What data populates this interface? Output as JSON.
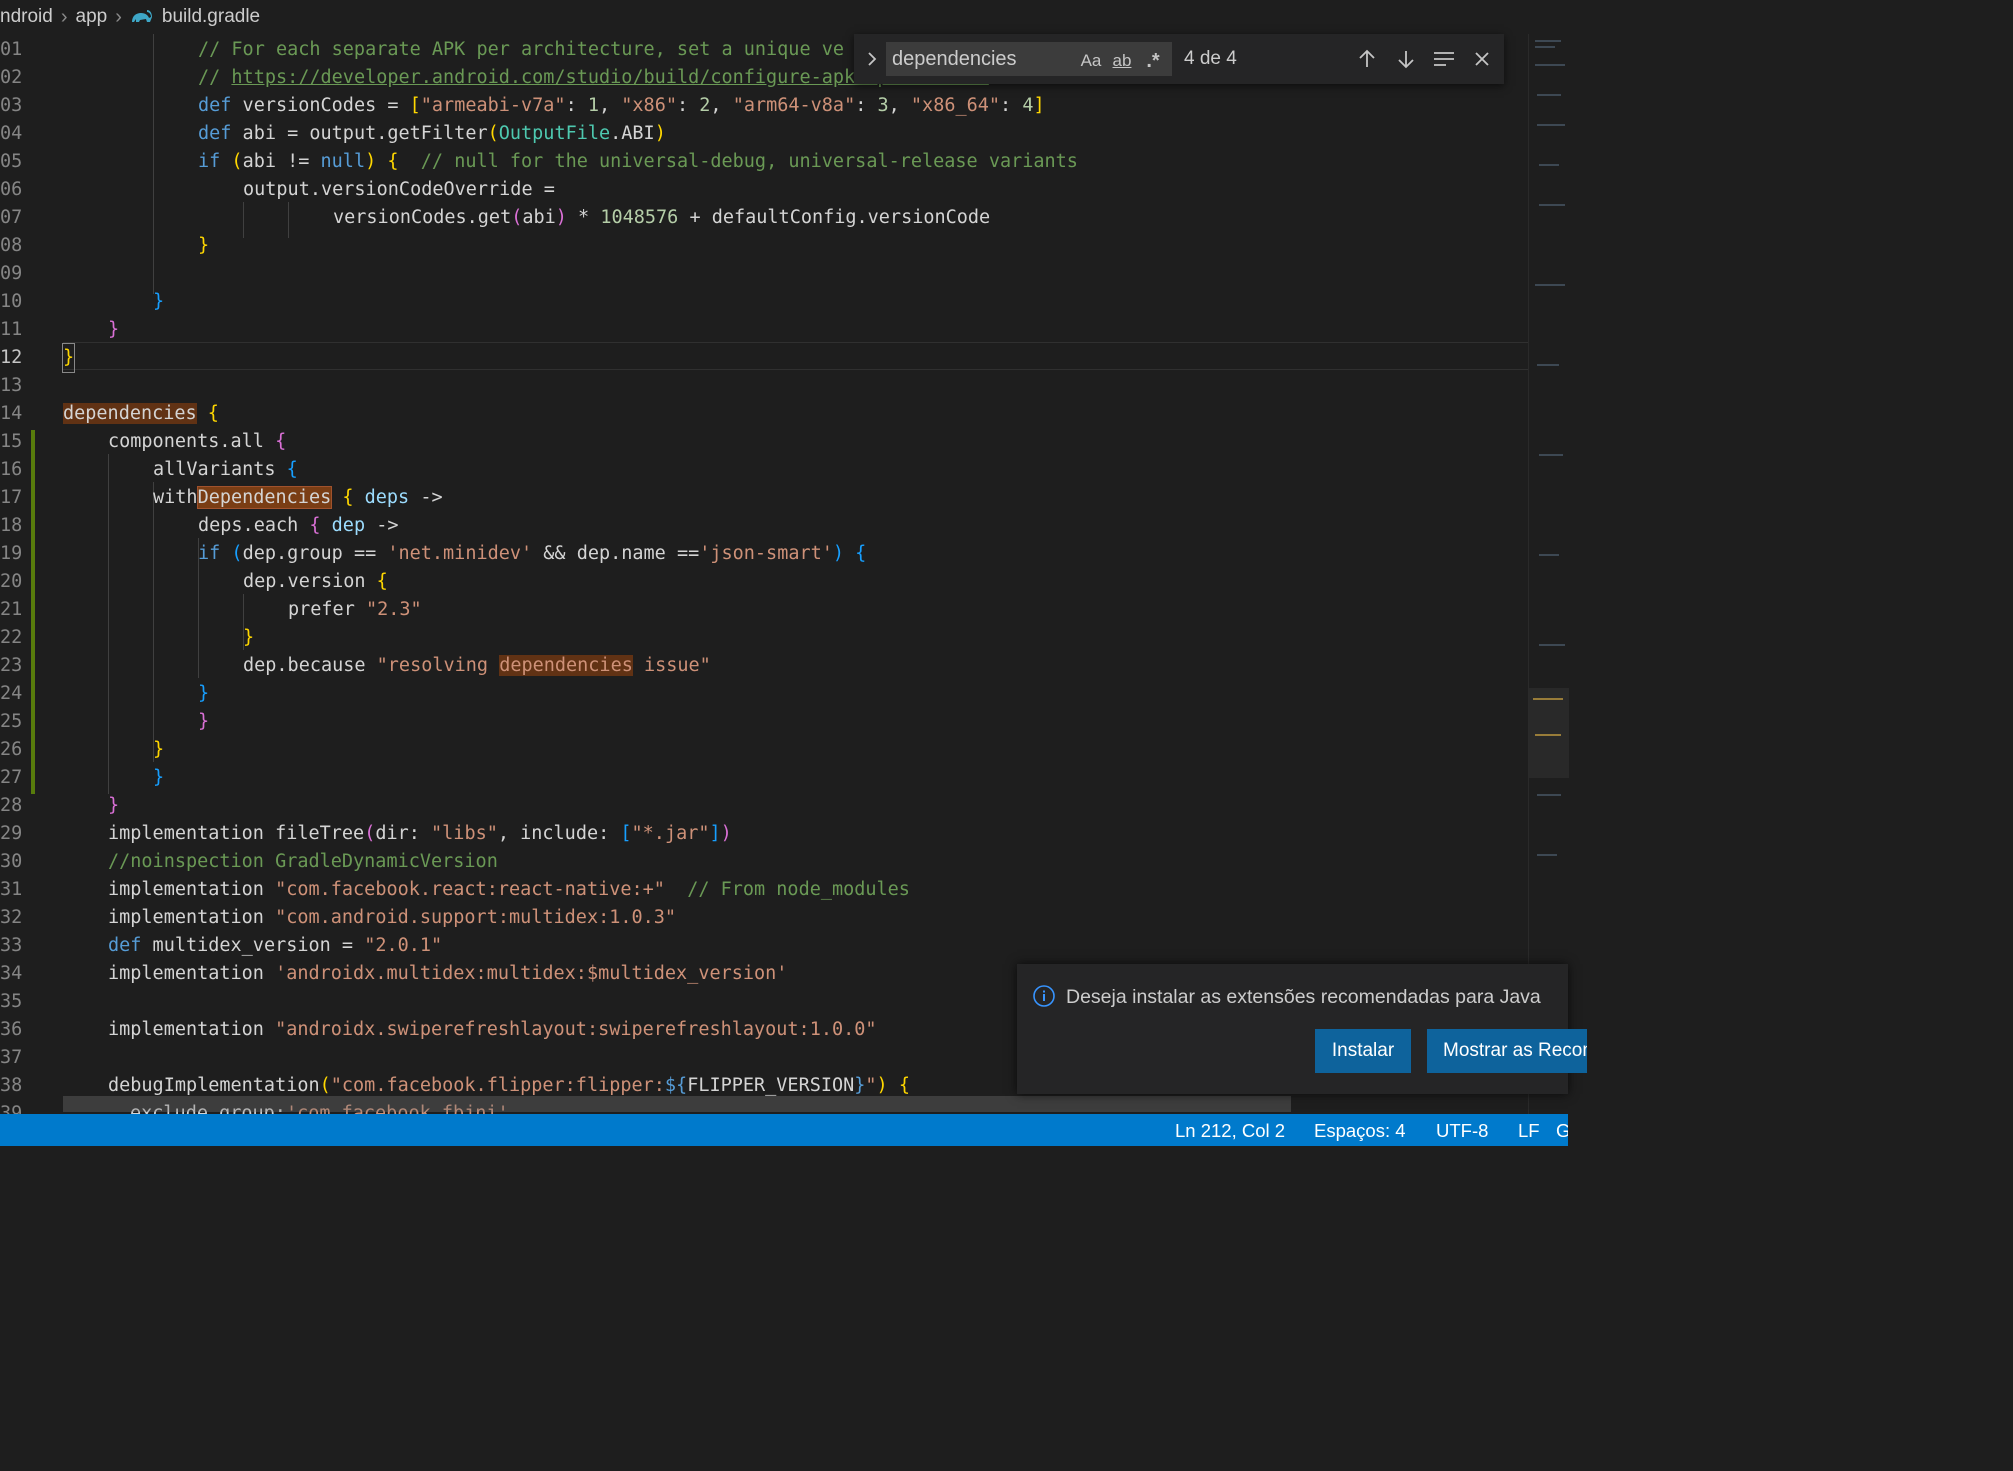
{
  "breadcrumb": {
    "items": [
      "ndroid",
      "app",
      "build.gradle"
    ],
    "file_icon": "gradle-elephant-icon"
  },
  "editor": {
    "current_line": "12",
    "lines": [
      {
        "no": "01",
        "text": "// For each separate APK per architecture, set a unique ve"
      },
      {
        "no": "02",
        "text": "// https://developer.android.com/studio/build/configure-apk-splits.html"
      },
      {
        "no": "03",
        "text": "def versionCodes = [\"armeabi-v7a\": 1, \"x86\": 2, \"arm64-v8a\": 3, \"x86_64\": 4]"
      },
      {
        "no": "04",
        "text": "def abi = output.getFilter(OutputFile.ABI)"
      },
      {
        "no": "05",
        "text": "if (abi != null) {  // null for the universal-debug, universal-release variants"
      },
      {
        "no": "06",
        "text": "output.versionCodeOverride ="
      },
      {
        "no": "07",
        "text": "versionCodes.get(abi) * 1048576 + defaultConfig.versionCode"
      },
      {
        "no": "08",
        "text": "}"
      },
      {
        "no": "09",
        "text": ""
      },
      {
        "no": "10",
        "text": "}"
      },
      {
        "no": "11",
        "text": "}"
      },
      {
        "no": "12",
        "text": "}"
      },
      {
        "no": "13",
        "text": ""
      },
      {
        "no": "14",
        "text": "dependencies {"
      },
      {
        "no": "15",
        "text": "components.all {"
      },
      {
        "no": "16",
        "text": "allVariants {"
      },
      {
        "no": "17",
        "text": "withDependencies { deps ->"
      },
      {
        "no": "18",
        "text": "deps.each { dep ->"
      },
      {
        "no": "19",
        "text": "if (dep.group == 'net.minidev' && dep.name =='json-smart') {"
      },
      {
        "no": "20",
        "text": "dep.version {"
      },
      {
        "no": "21",
        "text": "prefer \"2.3\""
      },
      {
        "no": "22",
        "text": "}"
      },
      {
        "no": "23",
        "text": "dep.because \"resolving dependencies issue\""
      },
      {
        "no": "24",
        "text": "}"
      },
      {
        "no": "25",
        "text": "}"
      },
      {
        "no": "26",
        "text": "}"
      },
      {
        "no": "27",
        "text": "}"
      },
      {
        "no": "28",
        "text": "}"
      },
      {
        "no": "29",
        "text": "implementation fileTree(dir: \"libs\", include: [\"*.jar\"])"
      },
      {
        "no": "30",
        "text": "//noinspection GradleDynamicVersion"
      },
      {
        "no": "31",
        "text": "implementation \"com.facebook.react:react-native:+\"  // From node_modules"
      },
      {
        "no": "32",
        "text": "implementation \"com.android.support:multidex:1.0.3\""
      },
      {
        "no": "33",
        "text": "def multidex_version = \"2.0.1\""
      },
      {
        "no": "34",
        "text": "implementation 'androidx.multidex:multidex:$multidex_version'"
      },
      {
        "no": "35",
        "text": ""
      },
      {
        "no": "36",
        "text": "implementation \"androidx.swiperefreshlayout:swiperefreshlayout:1.0.0\""
      },
      {
        "no": "37",
        "text": ""
      },
      {
        "no": "38",
        "text": "debugImplementation(\"com.facebook.flipper:flipper:${FLIPPER_VERSION}\") {"
      },
      {
        "no": "39",
        "text": "exclude group:'com.facebook.fbjni'"
      }
    ]
  },
  "find_widget": {
    "query": "dependencies",
    "match_case_label": "Aa",
    "whole_word_label": "ab",
    "regex_label": ".*",
    "count": "4 de 4",
    "icons": [
      "chevron-right-icon",
      "arrow-up-icon",
      "arrow-down-icon",
      "find-in-selection-icon",
      "close-icon"
    ]
  },
  "notification": {
    "message": "Deseja instalar as extensões recomendadas para Java",
    "install_label": "Instalar",
    "show_label": "Mostrar as Recomendações",
    "icon": "info-icon"
  },
  "statusbar": {
    "position": "Ln 212, Col 2",
    "indent": "Espaços: 4",
    "encoding": "UTF-8",
    "eol": "LF",
    "language": "Groovy"
  },
  "colors": {
    "keyword": "#569cd6",
    "string": "#ce9178",
    "number": "#b5cea8",
    "comment": "#6a9955",
    "type": "#4ec9b0",
    "find_highlight": "#613214",
    "status_bar": "#007acc",
    "button": "#0e639c"
  }
}
